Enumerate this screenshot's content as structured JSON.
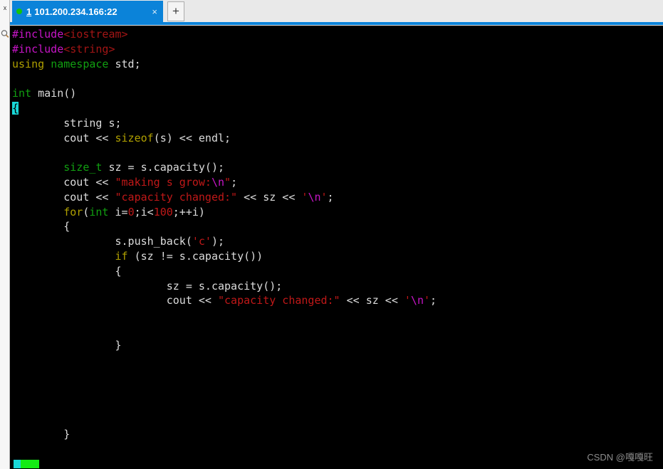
{
  "window": {
    "app_kind": "ssh-terminal",
    "accent_color": "#0b83d9",
    "terminal_bg": "#000000"
  },
  "left_rail": {
    "top_label": "x",
    "search_icon": "search-icon"
  },
  "tabbar": {
    "active_tab": {
      "index": "1",
      "title": "101.200.234.166:22",
      "status_dot_color": "#15c40a",
      "close_label": "×"
    },
    "new_tab_label": "+"
  },
  "terminal": {
    "lines": [
      {
        "segments": [
          {
            "t": "#include",
            "c": "pre"
          },
          {
            "t": "<iostream>",
            "c": "hdr"
          }
        ]
      },
      {
        "segments": [
          {
            "t": "#include",
            "c": "pre"
          },
          {
            "t": "<string>",
            "c": "hdr"
          }
        ]
      },
      {
        "segments": [
          {
            "t": "using",
            "c": "kw"
          },
          {
            "t": " ",
            "c": "txt"
          },
          {
            "t": "namespace",
            "c": "ns"
          },
          {
            "t": " std;",
            "c": "txt"
          }
        ]
      },
      {
        "segments": []
      },
      {
        "segments": [
          {
            "t": "int",
            "c": "ns"
          },
          {
            "t": " main()",
            "c": "txt"
          }
        ]
      },
      {
        "segments": [
          {
            "t": "{",
            "c": "cursor"
          }
        ]
      },
      {
        "segments": [
          {
            "t": "        string s;",
            "c": "txt"
          }
        ]
      },
      {
        "segments": [
          {
            "t": "        cout << ",
            "c": "txt"
          },
          {
            "t": "sizeof",
            "c": "kw"
          },
          {
            "t": "(s) << endl;",
            "c": "txt"
          }
        ]
      },
      {
        "segments": []
      },
      {
        "segments": [
          {
            "t": "        ",
            "c": "txt"
          },
          {
            "t": "size_t",
            "c": "ns"
          },
          {
            "t": " sz = s.capacity();",
            "c": "txt"
          }
        ]
      },
      {
        "segments": [
          {
            "t": "        cout << ",
            "c": "txt"
          },
          {
            "t": "\"making s grow:",
            "c": "str"
          },
          {
            "t": "\\n",
            "c": "esc"
          },
          {
            "t": "\"",
            "c": "str"
          },
          {
            "t": ";",
            "c": "txt"
          }
        ]
      },
      {
        "segments": [
          {
            "t": "        cout << ",
            "c": "txt"
          },
          {
            "t": "\"capacity changed:\"",
            "c": "str"
          },
          {
            "t": " << sz << ",
            "c": "txt"
          },
          {
            "t": "'",
            "c": "str"
          },
          {
            "t": "\\n",
            "c": "esc"
          },
          {
            "t": "'",
            "c": "str"
          },
          {
            "t": ";",
            "c": "txt"
          }
        ]
      },
      {
        "segments": [
          {
            "t": "        ",
            "c": "txt"
          },
          {
            "t": "for",
            "c": "kw"
          },
          {
            "t": "(",
            "c": "txt"
          },
          {
            "t": "int",
            "c": "ns"
          },
          {
            "t": " i=",
            "c": "txt"
          },
          {
            "t": "0",
            "c": "num"
          },
          {
            "t": ";i<",
            "c": "txt"
          },
          {
            "t": "100",
            "c": "num"
          },
          {
            "t": ";++i)",
            "c": "txt"
          }
        ]
      },
      {
        "segments": [
          {
            "t": "        {",
            "c": "txt"
          }
        ]
      },
      {
        "segments": [
          {
            "t": "                s.push_back(",
            "c": "txt"
          },
          {
            "t": "'c'",
            "c": "str"
          },
          {
            "t": ");",
            "c": "txt"
          }
        ]
      },
      {
        "segments": [
          {
            "t": "                ",
            "c": "txt"
          },
          {
            "t": "if",
            "c": "kw"
          },
          {
            "t": " (sz != s.capacity())",
            "c": "txt"
          }
        ]
      },
      {
        "segments": [
          {
            "t": "                {",
            "c": "txt"
          }
        ]
      },
      {
        "segments": [
          {
            "t": "                        sz = s.capacity();",
            "c": "txt"
          }
        ]
      },
      {
        "segments": [
          {
            "t": "                        cout << ",
            "c": "txt"
          },
          {
            "t": "\"capacity changed:\"",
            "c": "str"
          },
          {
            "t": " << sz << ",
            "c": "txt"
          },
          {
            "t": "'",
            "c": "str"
          },
          {
            "t": "\\n",
            "c": "esc"
          },
          {
            "t": "'",
            "c": "str"
          },
          {
            "t": ";",
            "c": "txt"
          }
        ]
      },
      {
        "segments": []
      },
      {
        "segments": []
      },
      {
        "segments": [
          {
            "t": "                }",
            "c": "txt"
          }
        ]
      },
      {
        "segments": []
      },
      {
        "segments": []
      },
      {
        "segments": []
      },
      {
        "segments": []
      },
      {
        "segments": []
      },
      {
        "segments": [
          {
            "t": "        }",
            "c": "txt"
          }
        ]
      }
    ]
  },
  "status": {
    "marker_cyan_color": "#19d7d7",
    "marker_green_color": "#14ec14"
  },
  "watermark": {
    "text": "CSDN @嘎嘎旺"
  }
}
